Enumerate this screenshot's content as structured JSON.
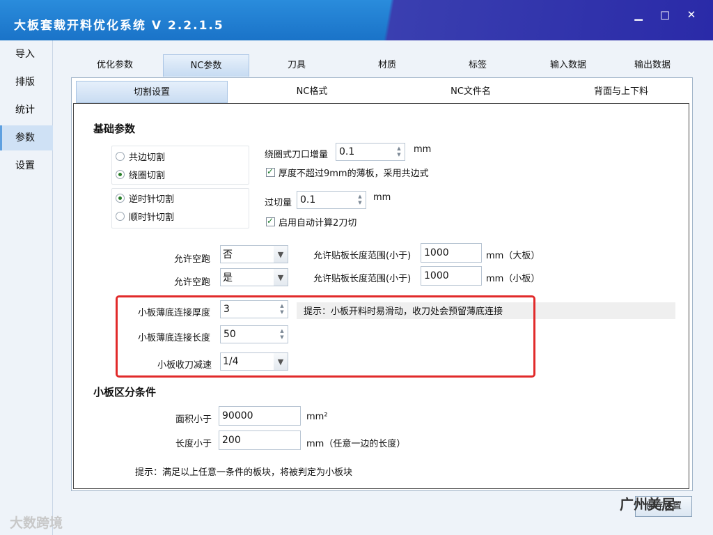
{
  "app": {
    "title": "大板套裁开料优化系统 V 2.2.1.5"
  },
  "window_controls": {
    "minimize": "▁",
    "maximize": "□",
    "close": "✕"
  },
  "leftnav": {
    "items": [
      {
        "label": "导入"
      },
      {
        "label": "排版"
      },
      {
        "label": "统计"
      },
      {
        "label": "参数",
        "active": true
      },
      {
        "label": "设置"
      }
    ]
  },
  "tabs_main": [
    {
      "label": "优化参数"
    },
    {
      "label": "NC参数",
      "active": true
    },
    {
      "label": "刀具"
    },
    {
      "label": "材质"
    },
    {
      "label": "标签"
    },
    {
      "label": "输入数据"
    },
    {
      "label": "输出数据"
    }
  ],
  "tabs_sub": [
    {
      "label": "切割设置",
      "active": true
    },
    {
      "label": "NC格式"
    },
    {
      "label": "NC文件名"
    },
    {
      "label": "背面与上下料"
    }
  ],
  "basic": {
    "heading": "基础参数",
    "cut_mode": {
      "option1": "共边切割",
      "option2": "绕圈切割",
      "selected": "绕圈切割"
    },
    "direction": {
      "option1": "逆时针切割",
      "option2": "顺时针切割",
      "selected": "逆时针切割"
    },
    "loop_increment": {
      "label": "绕圈式刀口增量",
      "value": "0.1",
      "unit": "mm"
    },
    "thin_board": {
      "label": "厚度不超过9mm的薄板，采用共边式",
      "checked": true
    },
    "overcut": {
      "label": "过切量",
      "value": "0.1",
      "unit": "mm"
    },
    "auto_second": {
      "label": "启用自动计算2刀切",
      "checked": true
    },
    "idle1": {
      "label": "允许空跑",
      "value": "否"
    },
    "idle2": {
      "label": "允许空跑",
      "value": "是"
    },
    "range1": {
      "label": "允许贴板长度范围(小于)",
      "value": "1000",
      "unit": "mm（大板）"
    },
    "range2": {
      "label": "允许贴板长度范围(小于)",
      "value": "1000",
      "unit": "mm（小板）"
    },
    "small_thick": {
      "label": "小板薄底连接厚度",
      "value": "3"
    },
    "small_hint": "提示：小板开料时易滑动，收刀处会预留薄底连接",
    "small_len": {
      "label": "小板薄底连接长度",
      "value": "50"
    },
    "small_slow": {
      "label": "小板收刀减速",
      "value": "1/4"
    }
  },
  "small": {
    "heading": "小板区分条件",
    "area": {
      "label": "面积小于",
      "value": "90000",
      "unit": "mm²"
    },
    "length": {
      "label": "长度小于",
      "value": "200",
      "unit": "mm（任意一边的长度）"
    },
    "hint": "提示：满足以上任意一条件的板块，将被判定为小板块"
  },
  "ok_button": "保存设置",
  "watermark": {
    "left": "大数跨境",
    "right": "广州美居"
  },
  "colors": {
    "titlebar": "#1a73c8",
    "accent_red": "#e12a2a",
    "nav_active": "#cfe1f5"
  }
}
